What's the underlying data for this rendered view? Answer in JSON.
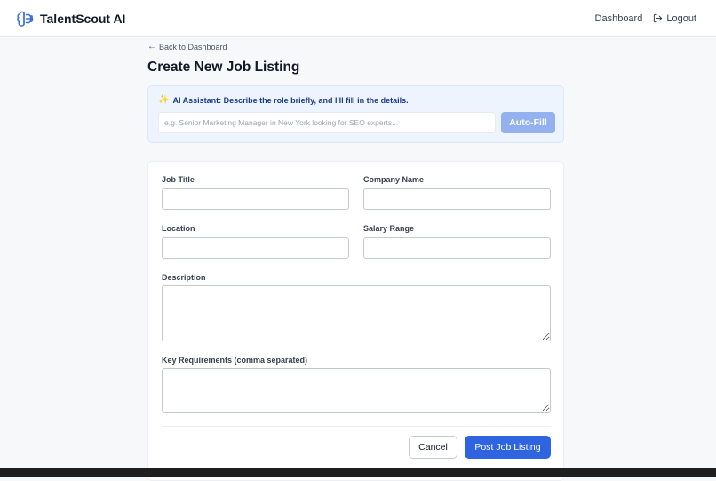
{
  "app": {
    "brand_name": "TalentScout AI",
    "brand_icon": "brain-icon"
  },
  "nav": {
    "dashboard_label": "Dashboard",
    "logout_label": "Logout",
    "logout_icon": "logout-icon"
  },
  "page": {
    "back_label": "Back to Dashboard",
    "title": "Create New Job Listing"
  },
  "ai_assistant": {
    "label": "AI Assistant: Describe the role briefly, and I'll fill in the details.",
    "icon": "sparkle-icon",
    "input_value": "",
    "input_placeholder": "e.g. Senior Marketing Manager in New York looking for SEO experts...",
    "button_label": "Auto-Fill"
  },
  "form": {
    "job_title_label": "Job Title",
    "job_title_value": "",
    "company_name_label": "Company Name",
    "company_name_value": "",
    "location_label": "Location",
    "location_value": "",
    "salary_range_label": "Salary Range",
    "salary_range_value": "",
    "description_label": "Description",
    "description_value": "",
    "requirements_label": "Key Requirements (comma separated)",
    "requirements_value": "",
    "cancel_label": "Cancel",
    "submit_label": "Post Job Listing"
  },
  "colors": {
    "primary": "#2f64e0",
    "autofill_disabled": "#93b1ee",
    "ai_panel_bg": "#eef4fd",
    "brand_icon": "#3b6fd8"
  }
}
